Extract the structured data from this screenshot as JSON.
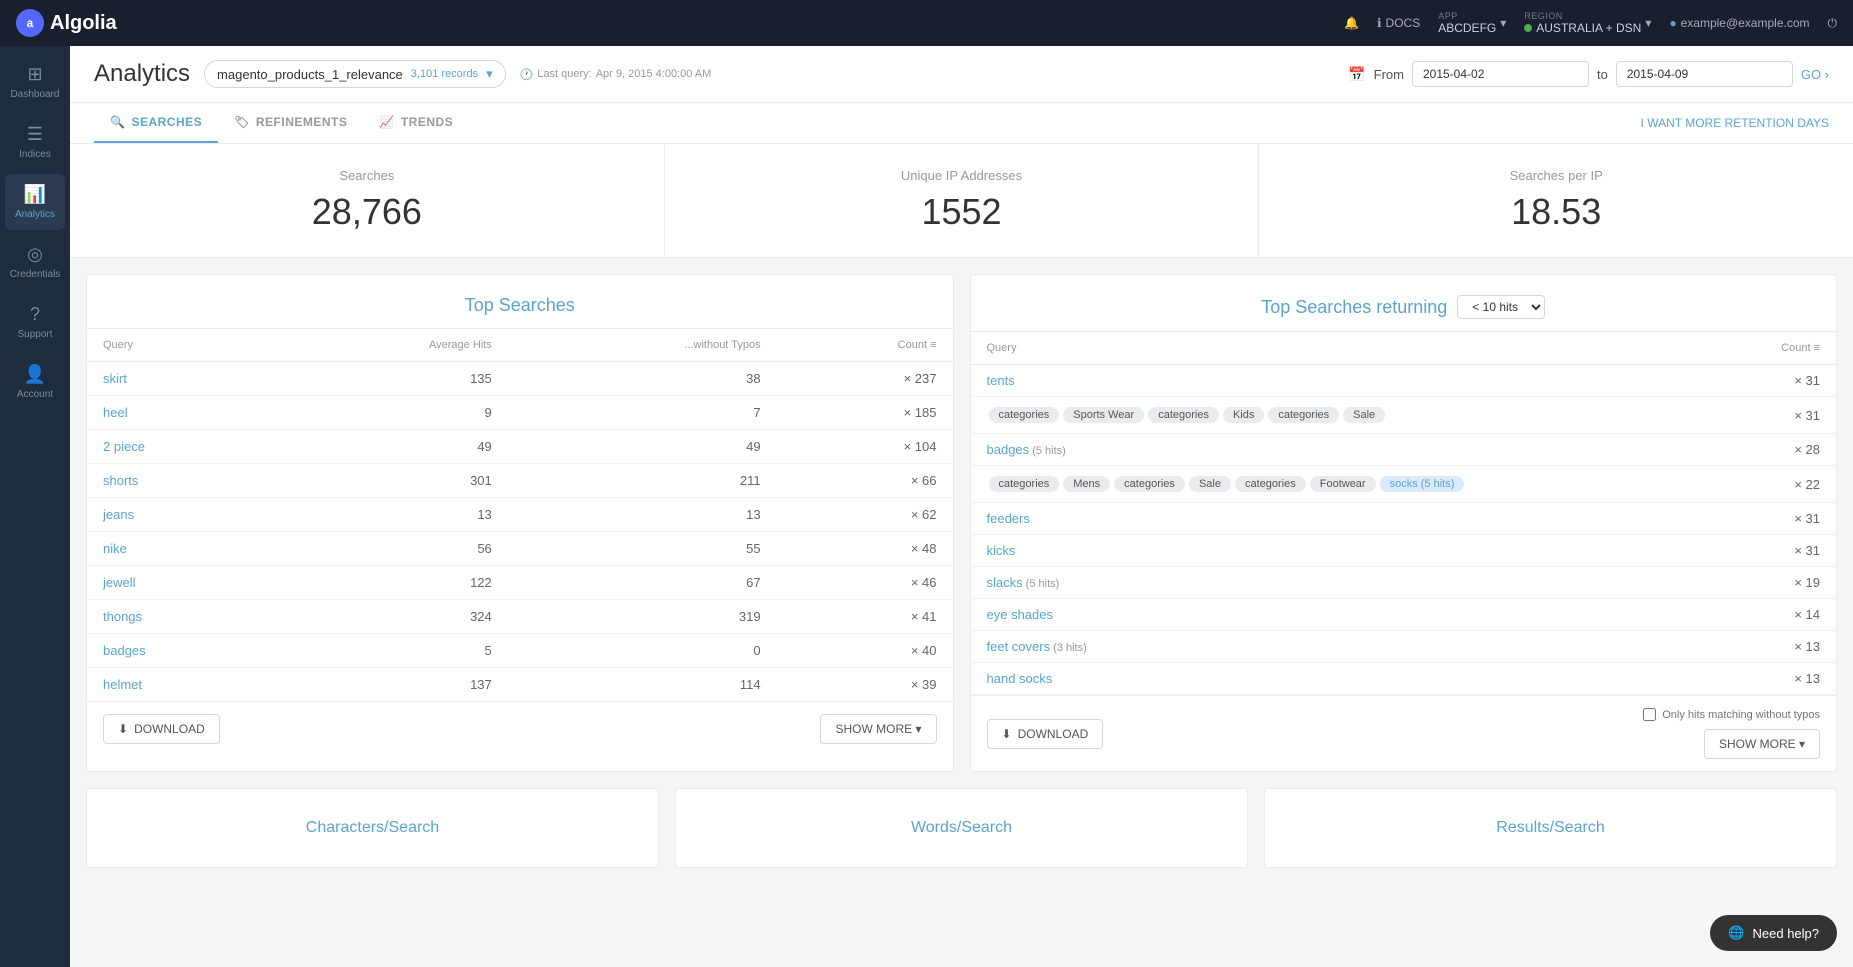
{
  "topnav": {
    "logo_text": "Algolia",
    "docs_label": "DOCS",
    "app_label": "APP",
    "app_name": "ABCDEFG",
    "region_label": "REGION",
    "region_name": "AUSTRALIA + DSN",
    "user_email": "example@example.com",
    "notification_icon": "🔔",
    "power_icon": "⏻"
  },
  "sidebar": {
    "items": [
      {
        "id": "dashboard",
        "label": "Dashboard",
        "icon": "⊞"
      },
      {
        "id": "indices",
        "label": "Indices",
        "icon": "☰"
      },
      {
        "id": "analytics",
        "label": "Analytics",
        "icon": "📊"
      },
      {
        "id": "credentials",
        "label": "Credentials",
        "icon": "◎"
      },
      {
        "id": "support",
        "label": "Support",
        "icon": "?"
      },
      {
        "id": "my-account",
        "label": "Account",
        "icon": "👤"
      }
    ]
  },
  "page": {
    "title": "Analytics",
    "index_name": "magento_products_1_relevance",
    "record_count": "3,101 records",
    "last_query_label": "Last query:",
    "last_query_date": "Apr 9, 2015 4:00:00 AM",
    "date_from_label": "From",
    "date_from": "2015-04-02",
    "date_to_label": "to",
    "date_to": "2015-04-09",
    "go_label": "GO ›",
    "retention_label": "I WANT MORE RETENTION DAYS"
  },
  "tabs": {
    "items": [
      {
        "id": "searches",
        "label": "SEARCHES",
        "active": true
      },
      {
        "id": "refinements",
        "label": "REFINEMENTS",
        "active": false
      },
      {
        "id": "trends",
        "label": "TRENDS",
        "active": false
      }
    ]
  },
  "stats": {
    "searches_label": "Searches",
    "searches_value": "28,766",
    "unique_ip_label": "Unique IP Addresses",
    "unique_ip_value": "1552",
    "searches_per_ip_label": "Searches per IP",
    "searches_per_ip_value": "18.53"
  },
  "top_searches": {
    "title": "Top Searches",
    "columns": {
      "query": "Query",
      "avg_hits": "Average Hits",
      "without_typos": "...without Typos",
      "count": "Count ≡"
    },
    "rows": [
      {
        "query": "skirt",
        "avg_hits": "135",
        "without_typos": "38",
        "count": "× 237"
      },
      {
        "query": "heel",
        "avg_hits": "9",
        "without_typos": "7",
        "count": "× 185"
      },
      {
        "query": "2 piece",
        "avg_hits": "49",
        "without_typos": "49",
        "count": "× 104"
      },
      {
        "query": "shorts",
        "avg_hits": "301",
        "without_typos": "211",
        "count": "× 66"
      },
      {
        "query": "jeans",
        "avg_hits": "13",
        "without_typos": "13",
        "count": "× 62"
      },
      {
        "query": "nike",
        "avg_hits": "56",
        "without_typos": "55",
        "count": "× 48"
      },
      {
        "query": "jewell",
        "avg_hits": "122",
        "without_typos": "67",
        "count": "× 46"
      },
      {
        "query": "thongs",
        "avg_hits": "324",
        "without_typos": "319",
        "count": "× 41"
      },
      {
        "query": "badges",
        "avg_hits": "5",
        "without_typos": "0",
        "count": "× 40"
      },
      {
        "query": "helmet",
        "avg_hits": "137",
        "without_typos": "114",
        "count": "× 39"
      }
    ],
    "download_label": "DOWNLOAD",
    "show_more_label": "SHOW MORE ▾"
  },
  "top_searches_returning": {
    "title": "Top Searches returning",
    "hits_filter": "< 10 hits",
    "columns": {
      "query": "Query",
      "count": "Count ≡"
    },
    "rows": [
      {
        "query": "tents",
        "hint": "",
        "tags": [],
        "count": "× 31"
      },
      {
        "query": "",
        "hint": "",
        "tags": [
          "categories",
          "Sports Wear",
          "categories",
          "Kids",
          "categories",
          "Sale"
        ],
        "count": "× 31"
      },
      {
        "query": "badges",
        "hint": "(5 hits)",
        "tags": [],
        "count": "× 28"
      },
      {
        "query": "",
        "hint": "",
        "tags": [
          "categories",
          "Mens",
          "categories",
          "Sale",
          "categories",
          "Footwear",
          "socks (5 hits)"
        ],
        "count": "× 22",
        "tag_has_link": true
      },
      {
        "query": "feeders",
        "hint": "",
        "tags": [],
        "count": "× 31"
      },
      {
        "query": "kicks",
        "hint": "",
        "tags": [],
        "count": "× 31"
      },
      {
        "query": "slacks",
        "hint": "(5 hits)",
        "tags": [],
        "count": "× 19"
      },
      {
        "query": "eye shades",
        "hint": "",
        "tags": [],
        "count": "× 14"
      },
      {
        "query": "feet covers",
        "hint": "(3 hits)",
        "tags": [],
        "count": "× 13"
      },
      {
        "query": "hand socks",
        "hint": "",
        "tags": [],
        "count": "× 13"
      }
    ],
    "checkbox_label": "Only hits matching without typos",
    "download_label": "DOWNLOAD",
    "show_more_label": "SHOW MORE ▾"
  },
  "bottom_cards": [
    {
      "id": "chars-per-search",
      "label": "Characters/Search"
    },
    {
      "id": "words-per-search",
      "label": "Words/Search"
    },
    {
      "id": "results-per-search",
      "label": "Results/Search"
    }
  ],
  "help": {
    "label": "Need help?",
    "icon": "🌐"
  }
}
